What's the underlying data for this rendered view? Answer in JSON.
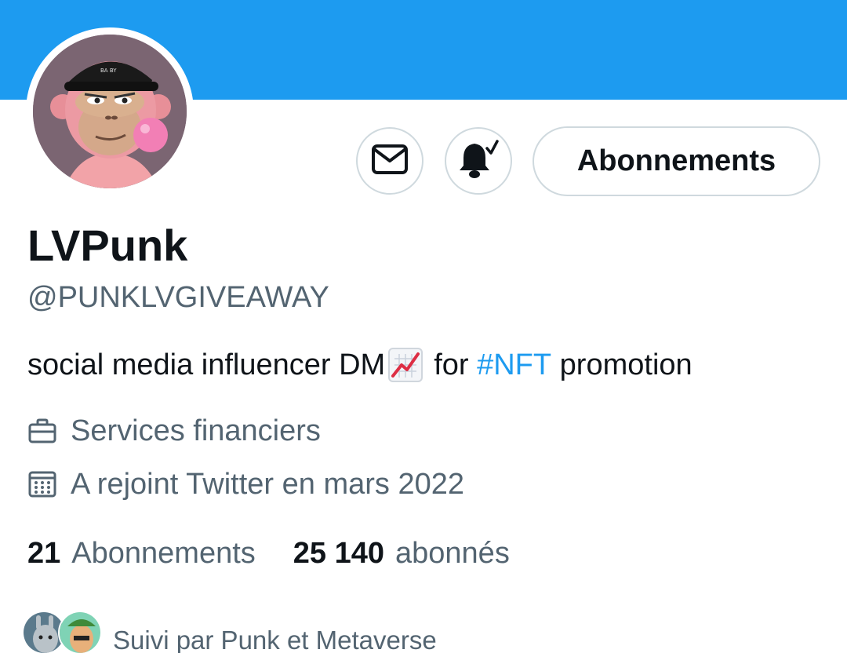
{
  "profile": {
    "display_name": "LVPunk",
    "handle": "@PUNKLVGIVEAWAY",
    "bio": {
      "part1": "social media influencer DM",
      "emoji_icon": "chart-increasing-icon",
      "part2": "for",
      "hashtag": "#NFT",
      "part3": "promotion"
    },
    "category": "Services financiers",
    "joined": "A rejoint Twitter en mars 2022",
    "following_count": "21",
    "following_label": "Abonnements",
    "followers_count": "25 140",
    "followers_label": "abonnés",
    "followed_by": "Suivi par Punk et Metaverse"
  },
  "actions": {
    "message_icon": "mail-icon",
    "notify_icon": "bell-check-icon",
    "follow_label": "Abonnements"
  },
  "colors": {
    "banner": "#1d9bf0",
    "link": "#1d9bf0",
    "secondary_text": "#536471",
    "border": "#cfd9de"
  }
}
